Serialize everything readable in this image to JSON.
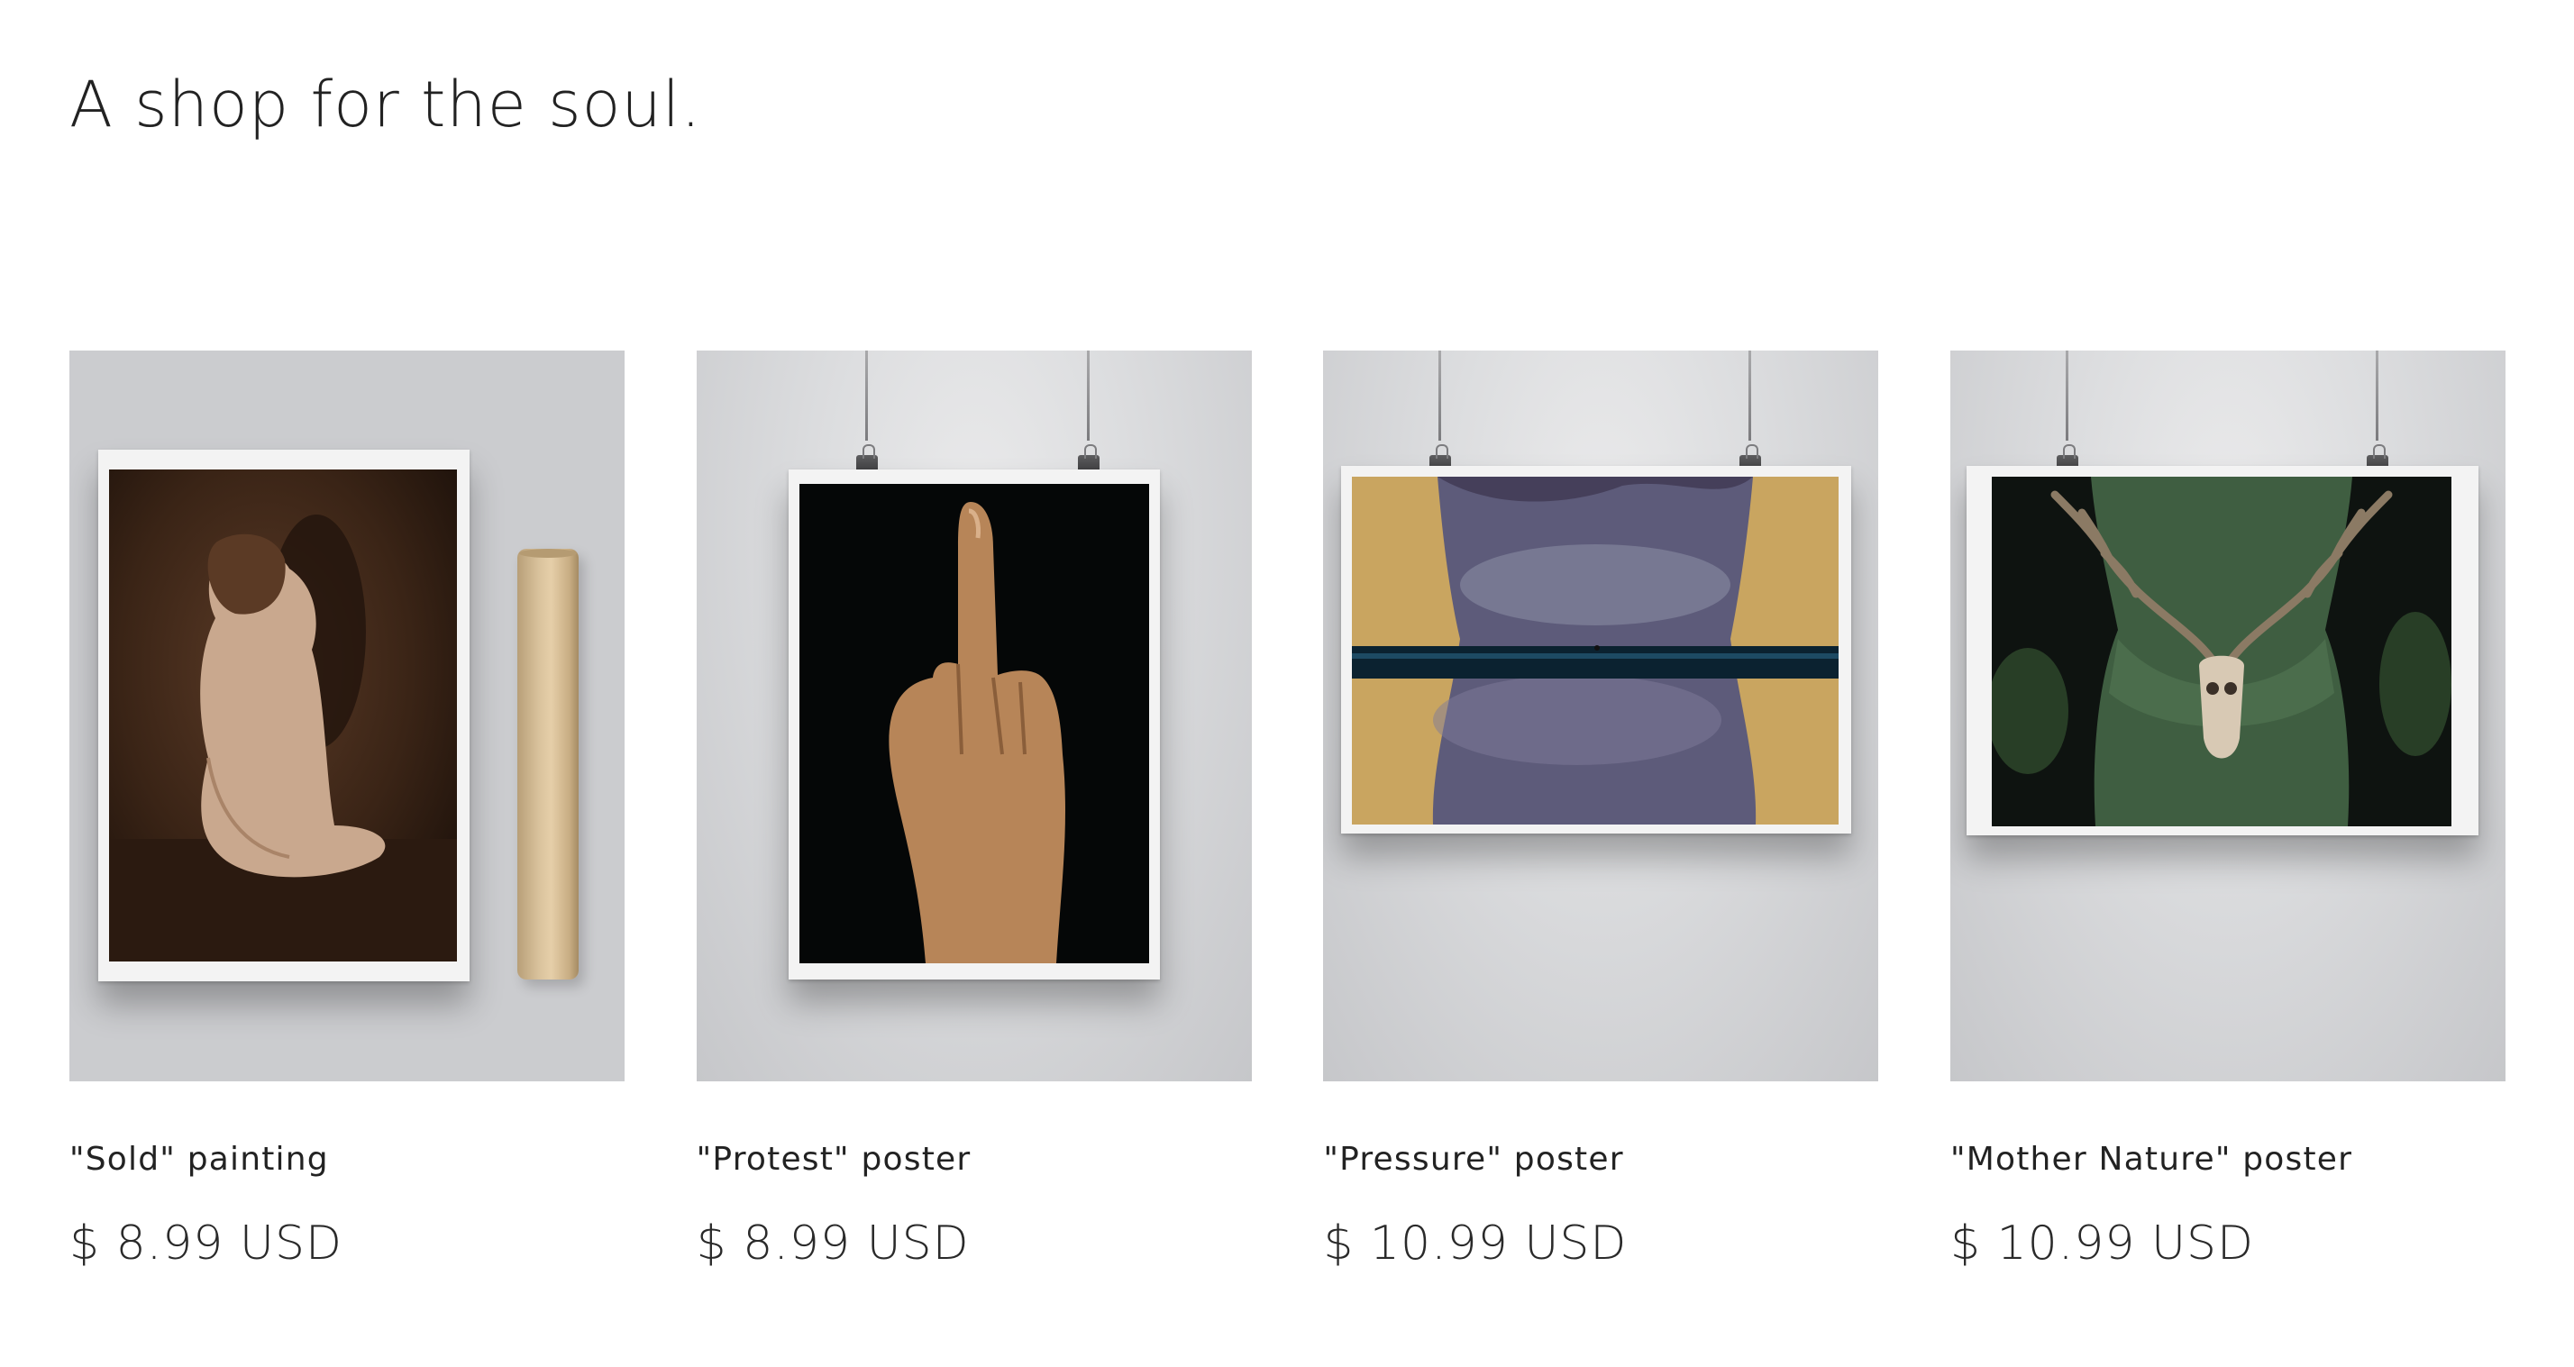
{
  "header": {
    "title": "A shop for the soul."
  },
  "products": [
    {
      "name": "\"Sold\" painting",
      "price": "$ 8.99 USD",
      "image_subject": "seated-nude-painting",
      "display": "print-with-paper-tube"
    },
    {
      "name": "\"Protest\" poster",
      "price": "$ 8.99 USD",
      "image_subject": "raised-middle-finger-painting",
      "display": "hanging-poster-portrait"
    },
    {
      "name": "\"Pressure\" poster",
      "price": "$ 10.99 USD",
      "image_subject": "torso-with-waterline-painting",
      "display": "hanging-poster-landscape"
    },
    {
      "name": "\"Mother Nature\" poster",
      "price": "$ 10.99 USD",
      "image_subject": "figure-with-antler-skull-painting",
      "display": "hanging-poster-landscape"
    }
  ],
  "colors": {
    "text": "#222222",
    "background": "#ffffff",
    "thumb_background": "#d6d7d9"
  }
}
